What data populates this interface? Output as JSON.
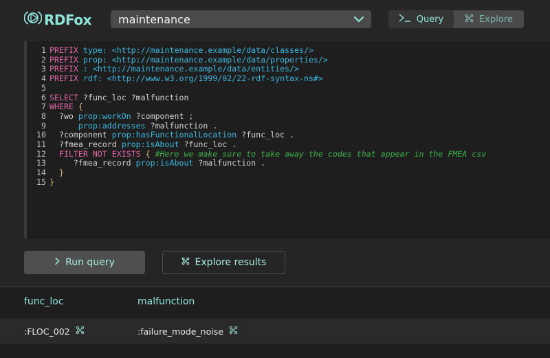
{
  "app": {
    "name": "RDFox"
  },
  "datastore_select": {
    "value": "maintenance"
  },
  "mode_tabs": [
    {
      "label": "Query",
      "icon": "terminal-icon",
      "active": true
    },
    {
      "label": "Explore",
      "icon": "graph-explore-icon",
      "active": false
    }
  ],
  "editor": {
    "lines": [
      {
        "n": "1",
        "segments": [
          {
            "t": "PREFIX",
            "c": "kw"
          },
          {
            "t": " ",
            "c": ""
          },
          {
            "t": "type:",
            "c": "pf"
          },
          {
            "t": " ",
            "c": ""
          },
          {
            "t": "<http://maintenance.example/data/classes/>",
            "c": "uri"
          }
        ]
      },
      {
        "n": "2",
        "segments": [
          {
            "t": "PREFIX",
            "c": "kw"
          },
          {
            "t": " ",
            "c": ""
          },
          {
            "t": "prop:",
            "c": "pf"
          },
          {
            "t": " ",
            "c": ""
          },
          {
            "t": "<http://maintenance.example/data/properties/>",
            "c": "uri"
          }
        ]
      },
      {
        "n": "3",
        "segments": [
          {
            "t": "PREFIX",
            "c": "kw"
          },
          {
            "t": " ",
            "c": ""
          },
          {
            "t": ":",
            "c": "pf"
          },
          {
            "t": " ",
            "c": ""
          },
          {
            "t": "<http://maintenance.example/data/entities/>",
            "c": "uri"
          }
        ]
      },
      {
        "n": "4",
        "segments": [
          {
            "t": "PREFIX",
            "c": "kw"
          },
          {
            "t": " ",
            "c": ""
          },
          {
            "t": "rdf:",
            "c": "pf"
          },
          {
            "t": " ",
            "c": ""
          },
          {
            "t": "<http://www.w3.org/1999/02/22-rdf-syntax-ns#>",
            "c": "uri"
          }
        ]
      },
      {
        "n": "5",
        "segments": []
      },
      {
        "n": "6",
        "segments": [
          {
            "t": "SELECT",
            "c": "kw"
          },
          {
            "t": " ?func_loc ?malfunction",
            "c": ""
          }
        ]
      },
      {
        "n": "7",
        "segments": [
          {
            "t": "WHERE",
            "c": "kw"
          },
          {
            "t": " ",
            "c": ""
          },
          {
            "t": "{",
            "c": "br"
          }
        ]
      },
      {
        "n": "8",
        "segments": [
          {
            "t": "  ?wo ",
            "c": ""
          },
          {
            "t": "prop:workOn",
            "c": "pf"
          },
          {
            "t": " ?component ;",
            "c": ""
          }
        ]
      },
      {
        "n": "9",
        "segments": [
          {
            "t": "      ",
            "c": ""
          },
          {
            "t": "prop:addresses",
            "c": "pf"
          },
          {
            "t": " ?malfunction .",
            "c": ""
          }
        ]
      },
      {
        "n": "10",
        "segments": [
          {
            "t": "  ?component ",
            "c": ""
          },
          {
            "t": "prop:hasFunctionalLocation",
            "c": "pf"
          },
          {
            "t": " ?func_loc .",
            "c": ""
          }
        ]
      },
      {
        "n": "11",
        "segments": [
          {
            "t": "  ?fmea_record ",
            "c": ""
          },
          {
            "t": "prop:isAbout",
            "c": "pf"
          },
          {
            "t": " ?func_loc .",
            "c": ""
          }
        ]
      },
      {
        "n": "12",
        "segments": [
          {
            "t": "  FILTER NOT EXISTS",
            "c": "kw"
          },
          {
            "t": " ",
            "c": ""
          },
          {
            "t": "{",
            "c": "br"
          },
          {
            "t": " ",
            "c": ""
          },
          {
            "t": "#Here we make sure to take away the codes that appear in the FMEA csv",
            "c": "cm"
          }
        ]
      },
      {
        "n": "13",
        "segments": [
          {
            "t": "     ?fmea_record ",
            "c": ""
          },
          {
            "t": "prop:isAbout",
            "c": "pf"
          },
          {
            "t": " ?malfunction .",
            "c": ""
          }
        ]
      },
      {
        "n": "14",
        "segments": [
          {
            "t": "  ",
            "c": ""
          },
          {
            "t": "}",
            "c": "br"
          }
        ]
      },
      {
        "n": "15",
        "segments": [
          {
            "t": "}",
            "c": "br"
          }
        ]
      }
    ]
  },
  "actions": {
    "run_query": "Run query",
    "explore_results": "Explore results"
  },
  "results": {
    "columns": [
      "func_loc",
      "malfunction"
    ],
    "rows": [
      [
        ":FLOC_002",
        ":failure_mode_noise"
      ]
    ]
  },
  "colors": {
    "accent": "#8fe3d8",
    "keyword": "#e066a6",
    "prefix": "#3cb8e0",
    "comment": "#3faf4a"
  }
}
